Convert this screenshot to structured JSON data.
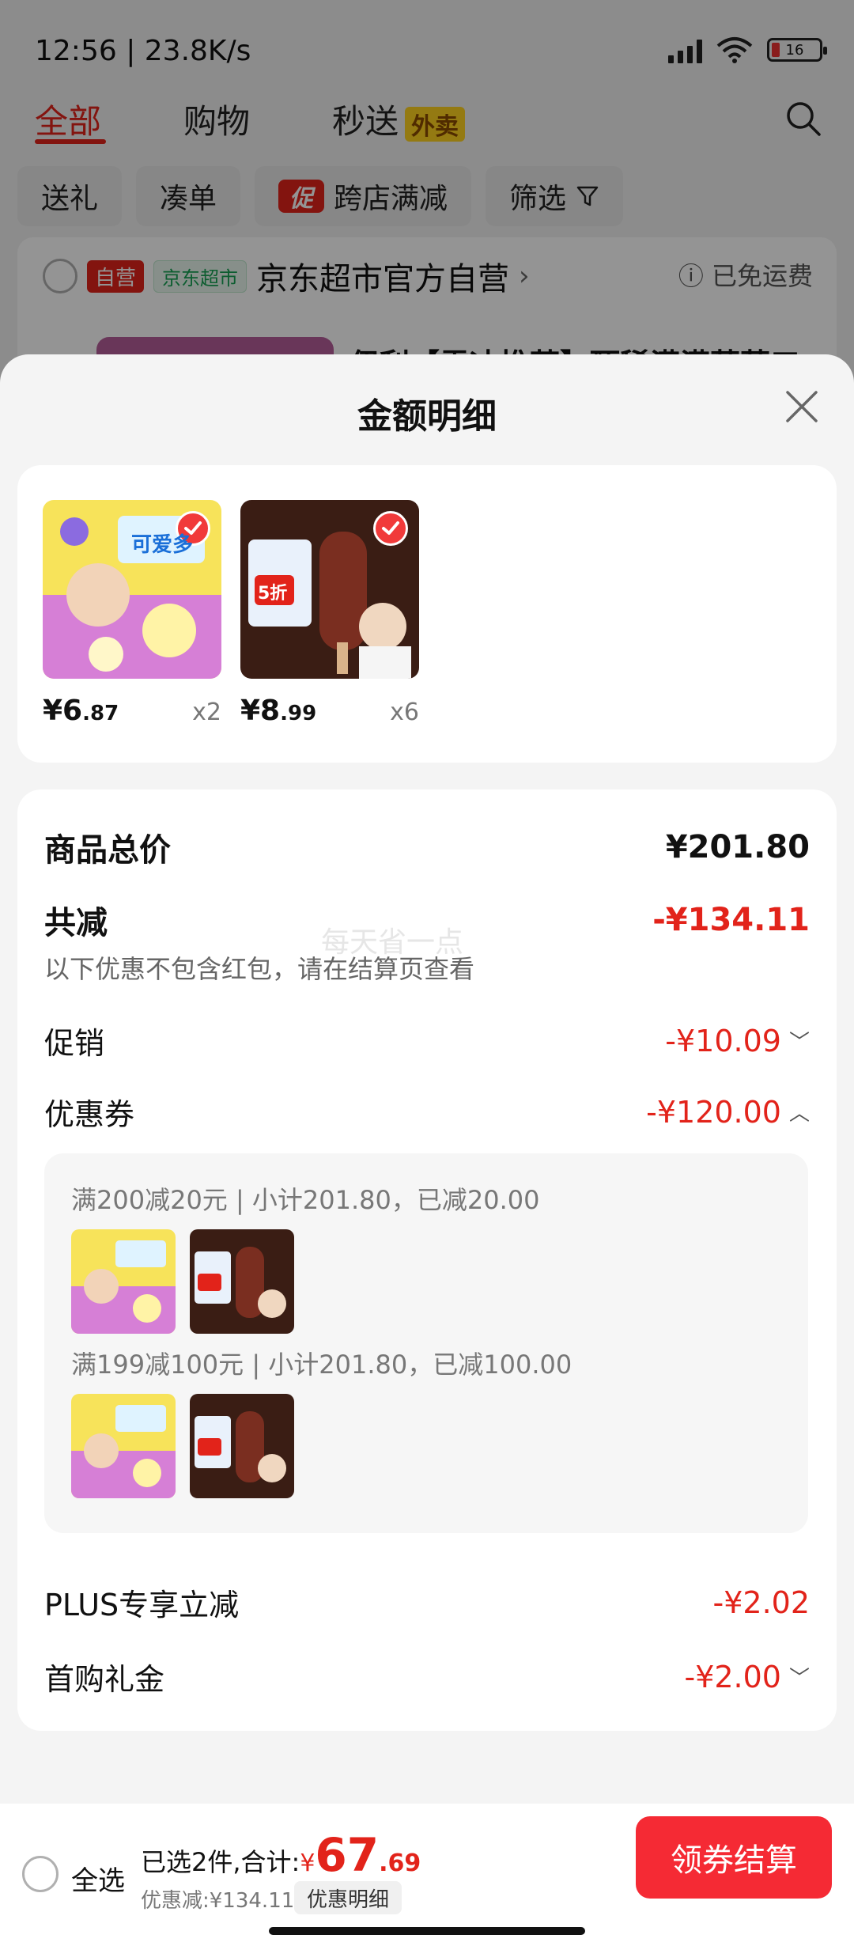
{
  "status_bar": {
    "time": "12:56 | 23.8K/s",
    "battery": "16"
  },
  "top_tabs": [
    {
      "label": "全部"
    },
    {
      "label": "购物"
    },
    {
      "label": "秒送",
      "badge": "外卖"
    }
  ],
  "filters": [
    {
      "label": "送礼"
    },
    {
      "label": "凑单"
    },
    {
      "label": "跨店满减",
      "badge": "促"
    },
    {
      "label": "筛选"
    }
  ],
  "store": {
    "tag_self": "自营",
    "tag_market": "京东超市",
    "name": "京东超市官方自营",
    "arrow": "›",
    "shipping": "ⓘ 已免运费",
    "partial_title": "伊利【雪冰推荐】甄稀满满莓莓口"
  },
  "sheet": {
    "title": "金额明细",
    "products": [
      {
        "price_int": "¥6",
        "price_dec": ".87",
        "qty": "x2",
        "image_label": "可爱多"
      },
      {
        "price_int": "¥8",
        "price_dec": ".99",
        "qty": "x6",
        "image_label": "5折"
      }
    ],
    "total_label": "商品总价",
    "total_value": "¥201.80",
    "reduce_label": "共减",
    "reduce_value": "-¥134.11",
    "reduce_note": "以下优惠不包含红包，请在结算页查看",
    "watermark": "每天省一点",
    "promo_label": "促销",
    "promo_value": "-¥10.09",
    "coupon_label": "优惠券",
    "coupon_value": "-¥120.00",
    "coupons": [
      {
        "text": "满200减20元 | 小计201.80，已减20.00"
      },
      {
        "text": "满199减100元 | 小计201.80，已减100.00"
      }
    ],
    "plus_label": "PLUS专享立减",
    "plus_value": "-¥2.02",
    "first_label": "首购礼金",
    "first_value": "-¥2.00"
  },
  "bottom_bar": {
    "select_all": "全选",
    "selected_text": "已选2件,合计:",
    "total_yen": "¥",
    "total_int": "67",
    "total_dec": ".69",
    "saved": "优惠减:¥134.11",
    "detail_button": "优惠明细",
    "checkout_button": "领券结算"
  },
  "colors": {
    "accent": "#e2231a",
    "checkout": "#f52a34",
    "waimai_badge": "#ffd21f"
  }
}
